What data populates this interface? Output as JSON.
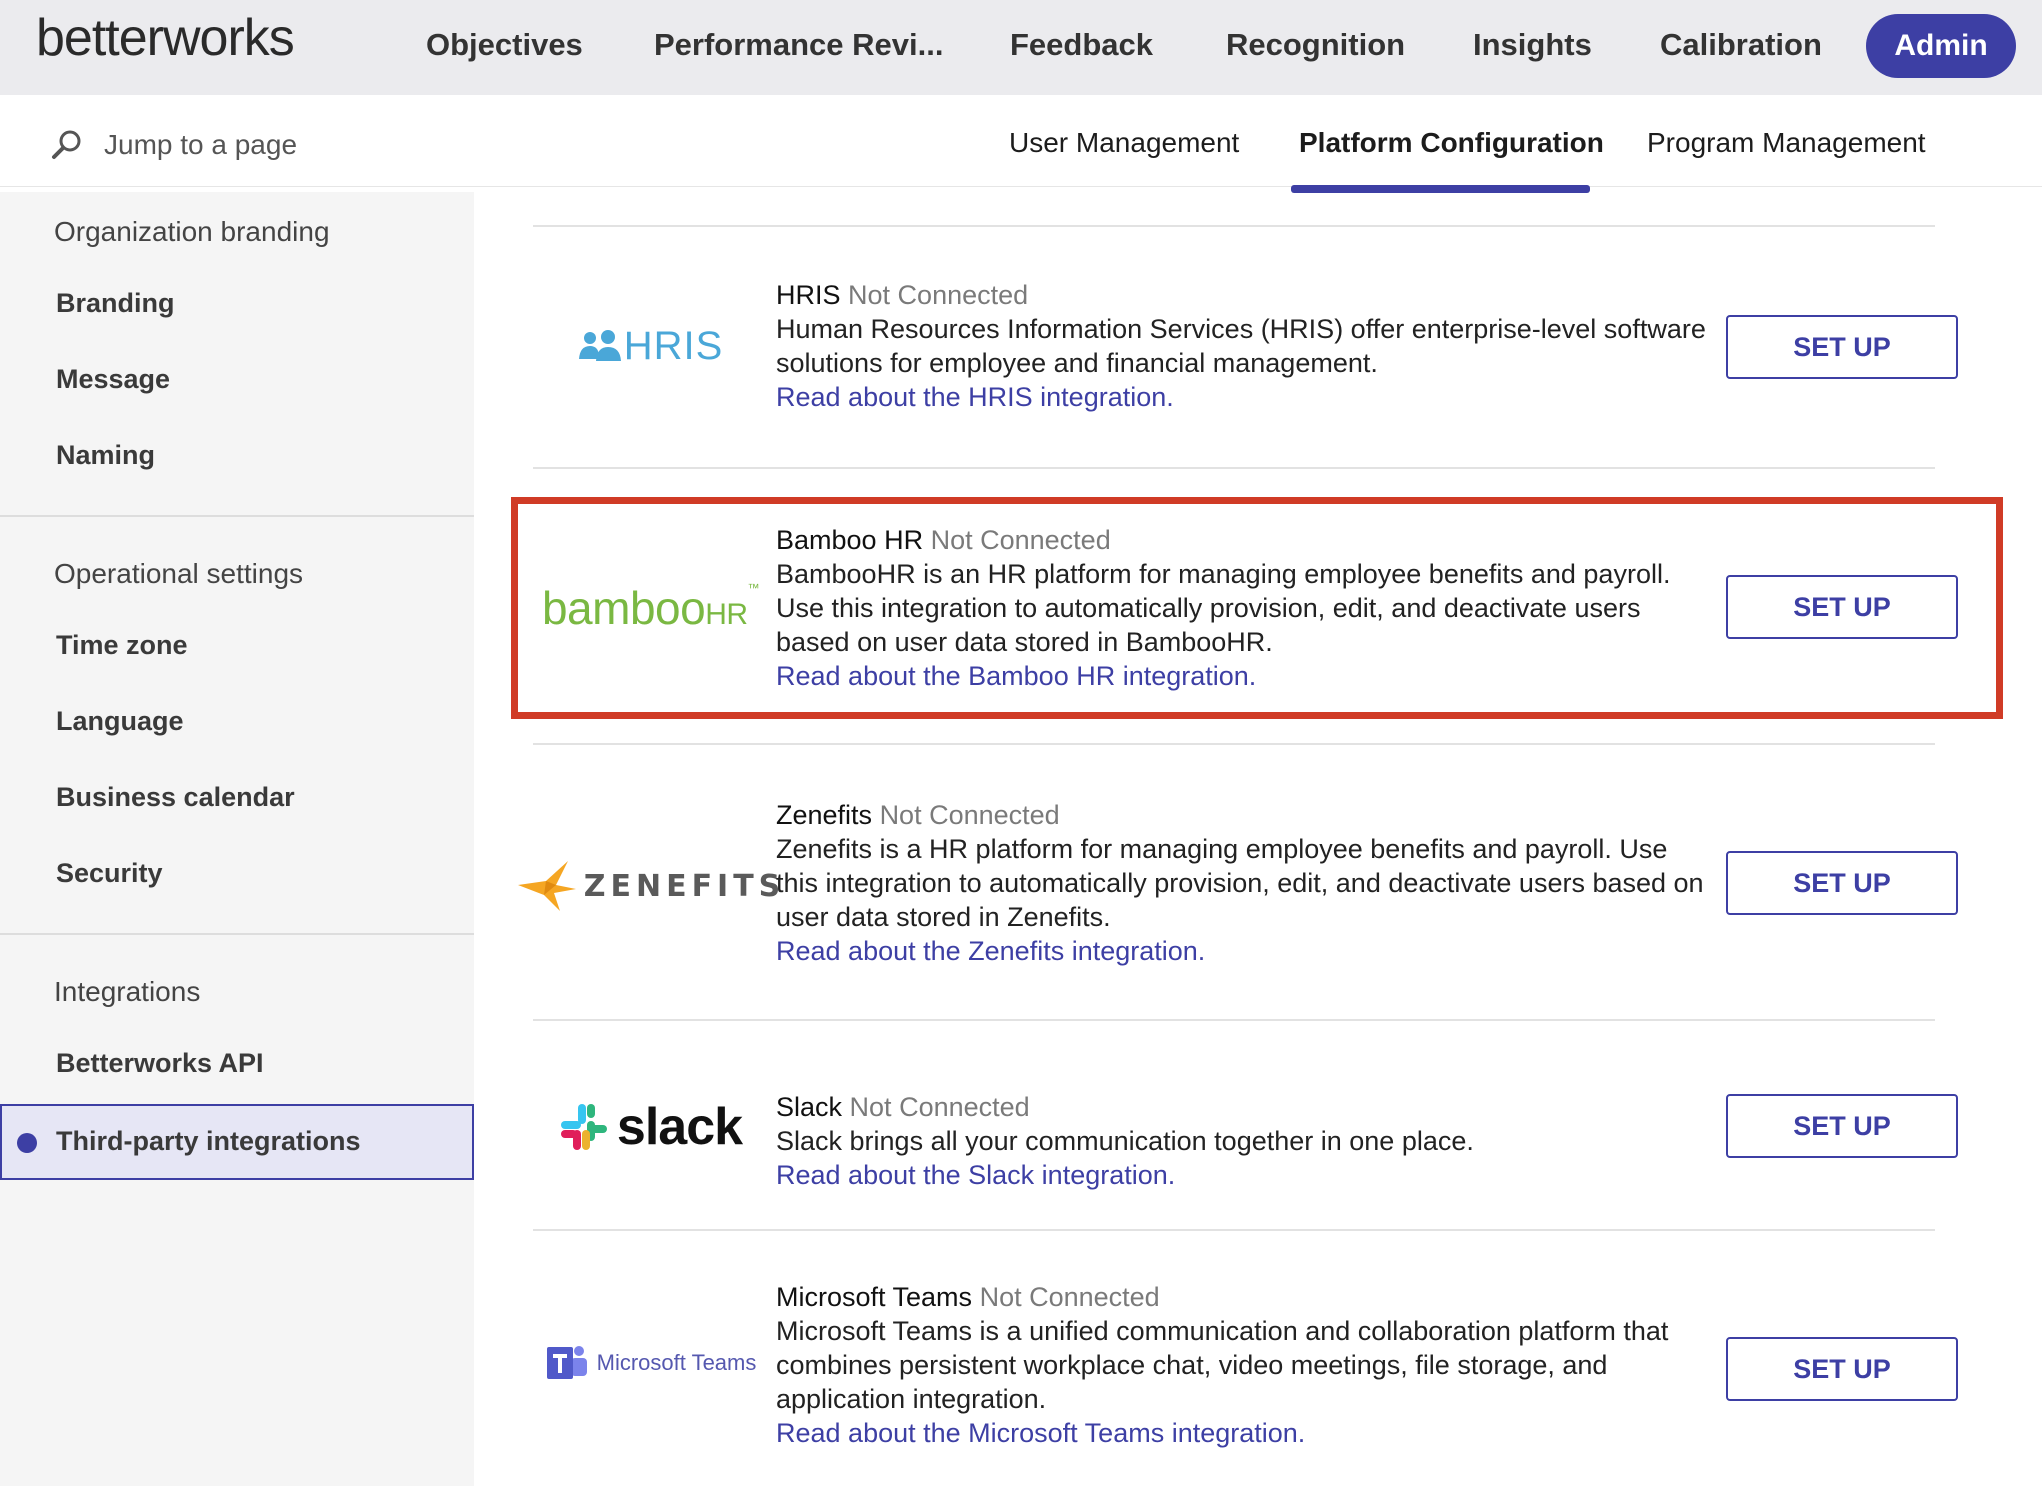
{
  "app": {
    "logo_text": "betterworks"
  },
  "topnav": {
    "items": [
      {
        "label": "Objectives"
      },
      {
        "label": "Performance Revi..."
      },
      {
        "label": "Feedback"
      },
      {
        "label": "Recognition"
      },
      {
        "label": "Insights"
      },
      {
        "label": "Calibration"
      }
    ],
    "admin_label": "Admin",
    "accent_color": "#3d3fa4"
  },
  "subheader": {
    "search_placeholder": "Jump to a page",
    "search_icon": "search-icon",
    "tabs": [
      {
        "label": "User Management"
      },
      {
        "label": "Platform Configuration",
        "active": true
      },
      {
        "label": "Program Management"
      }
    ]
  },
  "sidebar": {
    "sections": [
      {
        "heading": "Organization branding",
        "items": [
          "Branding",
          "Message",
          "Naming"
        ]
      },
      {
        "heading": "Operational settings",
        "items": [
          "Time zone",
          "Language",
          "Business calendar",
          "Security"
        ]
      },
      {
        "heading": "Integrations",
        "items": [
          "Betterworks API",
          "Third-party integrations"
        ]
      }
    ],
    "active_item": "Third-party integrations"
  },
  "integrations": [
    {
      "logo_text": "HRIS",
      "title": "HRIS",
      "status": "Not Connected",
      "description": "Human Resources Information Services (HRIS) offer enterprise-level software solutions for employee and financial management.",
      "link": "Read about the HRIS integration.",
      "button": "SET UP"
    },
    {
      "logo_text": "bamboo",
      "logo_text_hr": "HR",
      "logo_tm": "™",
      "title": "Bamboo HR",
      "status": "Not Connected",
      "description": "BambooHR is an HR platform for managing employee benefits and payroll. Use this integration to automatically provision, edit, and deactivate users based on user data stored in BambooHR.",
      "link": "Read about the Bamboo HR integration.",
      "button": "SET UP",
      "highlighted": true
    },
    {
      "logo_text": "ZENEFITS",
      "title": "Zenefits",
      "status": "Not Connected",
      "description": "Zenefits is a HR platform for managing employee benefits and payroll. Use this integration to automatically provision, edit, and deactivate users based on user data stored in Zenefits.",
      "link": "Read about the Zenefits integration.",
      "button": "SET UP"
    },
    {
      "logo_text": "slack",
      "title": "Slack",
      "status": "Not Connected",
      "description": "Slack brings all your communication together in one place.",
      "link": "Read about the Slack integration.",
      "button": "SET UP"
    },
    {
      "logo_text": "Microsoft Teams",
      "title": "Microsoft Teams",
      "status": "Not Connected",
      "description": "Microsoft Teams is a unified communication and collaboration platform that combines persistent workplace chat, video meetings, file storage, and application integration.",
      "link": "Read about the Microsoft Teams integration.",
      "button": "SET UP"
    }
  ],
  "colors": {
    "highlight_border": "#d03b26",
    "link": "#3d3fa4",
    "status": "#7a7a7a"
  }
}
